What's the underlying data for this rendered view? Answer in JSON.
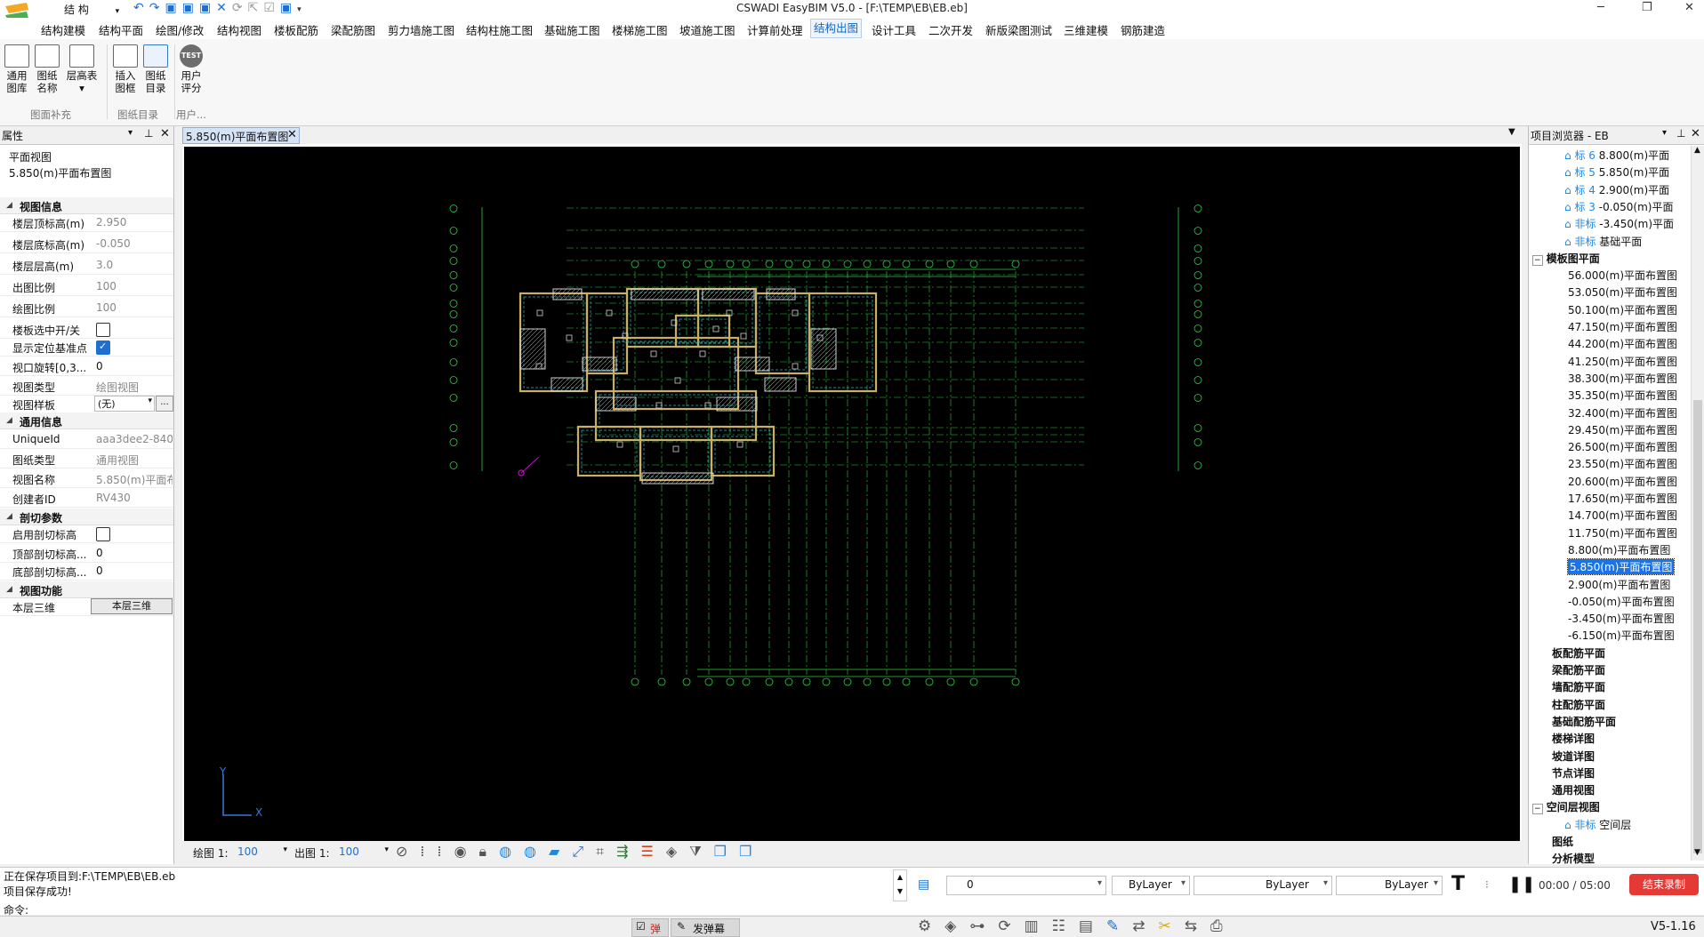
{
  "window": {
    "title": "CSWADI EasyBIM V5.0 - [F:\\TEMP\\EB\\EB.eb]",
    "qa_combo": "结 构"
  },
  "tabs": [
    "结构建模",
    "结构平面",
    "绘图/修改",
    "结构视图",
    "楼板配筋",
    "梁配筋图",
    "剪力墙施工图",
    "结构柱施工图",
    "基础施工图",
    "楼梯施工图",
    "坡道施工图",
    "计算前处理",
    "结构出图",
    "设计工具",
    "二次开发",
    "新版梁图测试",
    "三维建模",
    "钢筋建造"
  ],
  "active_tab": "结构出图",
  "ribbon": {
    "buttons": [
      {
        "l1": "通用",
        "l2": "图库"
      },
      {
        "l1": "图纸",
        "l2": "名称"
      },
      {
        "l1": "层高表",
        "l2": "▾"
      },
      {
        "l1": "插入",
        "l2": "图框"
      },
      {
        "l1": "图纸",
        "l2": "目录"
      },
      {
        "l1": "用户",
        "l2": "评分"
      }
    ],
    "test_badge": "TEST",
    "groups": [
      "图面补充",
      "图纸目录",
      "用户..."
    ]
  },
  "props": {
    "title": "属性",
    "type_line1": "平面视图",
    "type_line2": "5.850(m)平面布置图",
    "sections": {
      "view_info": "视图信息",
      "general_info": "通用信息",
      "clip": "剖切参数",
      "view_func": "视图功能"
    },
    "rows": [
      {
        "k": "楼层顶标高(m)",
        "v": "2.950"
      },
      {
        "k": "楼层底标高(m)",
        "v": "-0.050"
      },
      {
        "k": "楼层层高(m)",
        "v": "3.0"
      },
      {
        "k": "出图比例",
        "v": "100"
      },
      {
        "k": "绘图比例",
        "v": "100"
      },
      {
        "k": "楼板选中开/关",
        "v": ""
      },
      {
        "k": "显示定位基准点",
        "v": ""
      },
      {
        "k": "视口旋转[0,3...",
        "v": "0"
      },
      {
        "k": "视图类型",
        "v": "绘图视图"
      },
      {
        "k": "视图样板",
        "v": "(无)"
      }
    ],
    "general_rows": [
      {
        "k": "UniqueId",
        "v": "aaa3dee2-840"
      },
      {
        "k": "图纸类型",
        "v": "通用视图"
      },
      {
        "k": "视图名称",
        "v": "5.850(m)平面布"
      },
      {
        "k": "创建者ID",
        "v": "RV430"
      }
    ],
    "clip_rows": [
      {
        "k": "启用剖切标高",
        "v": ""
      },
      {
        "k": "顶部剖切标高...",
        "v": "0"
      },
      {
        "k": "底部剖切标高...",
        "v": "0"
      }
    ],
    "func_row": {
      "k": "本层三维",
      "btn": "本层三维"
    },
    "ellipsis": "..."
  },
  "viewport": {
    "tab_label": "5.850(m)平面布置图",
    "draw_scale_label": "绘图 1:",
    "draw_scale": "100",
    "out_scale_label": "出图 1:",
    "out_scale": "100",
    "ucs_y": "Y",
    "ucs_x": "X"
  },
  "browser": {
    "title": "项目浏览器 - EB",
    "top_items": [
      {
        "tag": "标 6",
        "name": "8.800(m)平面"
      },
      {
        "tag": "标 5",
        "name": "5.850(m)平面"
      },
      {
        "tag": "标 4",
        "name": "2.900(m)平面"
      },
      {
        "tag": "标 3",
        "name": "-0.050(m)平面"
      },
      {
        "tag": "非标",
        "name": "-3.450(m)平面"
      },
      {
        "tag": "非标",
        "name": "基础平面"
      }
    ],
    "template_header": "模板图平面",
    "plans": [
      "56.000(m)平面布置图",
      "53.050(m)平面布置图",
      "50.100(m)平面布置图",
      "47.150(m)平面布置图",
      "44.200(m)平面布置图",
      "41.250(m)平面布置图",
      "38.300(m)平面布置图",
      "35.350(m)平面布置图",
      "32.400(m)平面布置图",
      "29.450(m)平面布置图",
      "26.500(m)平面布置图",
      "23.550(m)平面布置图",
      "20.600(m)平面布置图",
      "17.650(m)平面布置图",
      "14.700(m)平面布置图",
      "11.750(m)平面布置图",
      "8.800(m)平面布置图",
      "5.850(m)平面布置图",
      "2.900(m)平面布置图",
      "-0.050(m)平面布置图",
      "-3.450(m)平面布置图",
      "-6.150(m)平面布置图"
    ],
    "selected_index": 17,
    "groups": [
      "板配筋平面",
      "梁配筋平面",
      "墙配筋平面",
      "柱配筋平面",
      "基础配筋平面",
      "楼梯详图",
      "坡道详图",
      "节点详图",
      "通用视图"
    ],
    "space_header": "空间层视图",
    "space_item": {
      "tag": "非标",
      "name": "空间层"
    },
    "tail": [
      "图纸",
      "分析模型"
    ]
  },
  "cmd": {
    "line1": "正在保存项目到:F:\\TEMP\\EB\\EB.eb",
    "line2": "项目保存成功!",
    "prompt": "命令:",
    "layer": "0",
    "color": "ByLayer",
    "linetype": "ByLayer",
    "lineweight": "ByLayer"
  },
  "recording": {
    "time": "00:00 / 05:00",
    "stop_label": "结束录制"
  },
  "bottom": {
    "toggle1": "弹",
    "toggle2": "发弹幕",
    "version": "V5-1.16"
  }
}
